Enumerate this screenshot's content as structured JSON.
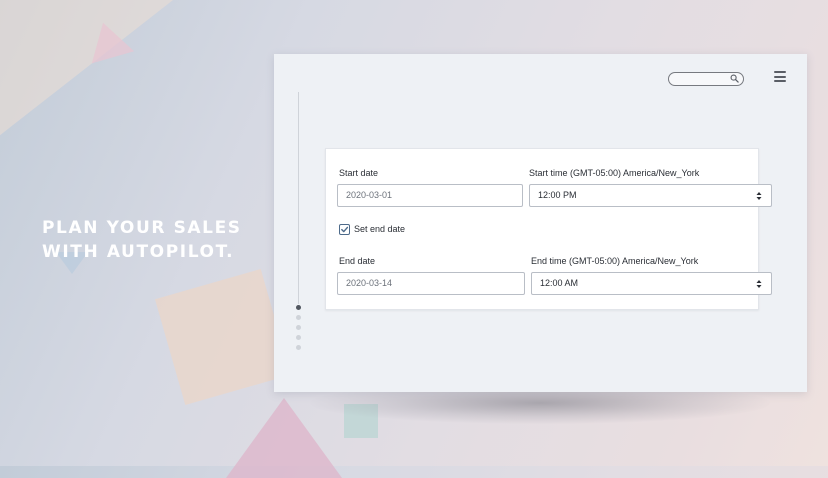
{
  "headline": {
    "line1": "PLAN YOUR SALES",
    "line2": "WITH AUTOPILOT."
  },
  "toolbar": {
    "search_value": "",
    "search_icon": "magnifier-icon",
    "menu_icon": "hamburger-icon"
  },
  "form": {
    "start_date_label": "Start date",
    "start_date_value": "2020-03-01",
    "start_time_label": "Start time (GMT-05:00) America/New_York",
    "start_time_value": "12:00 PM",
    "set_end_date_label": "Set end date",
    "set_end_date_checked": true,
    "end_date_label": "End date",
    "end_date_value": "2020-03-14",
    "end_time_label": "End time (GMT-05:00) America/New_York",
    "end_time_value": "12:00 AM"
  },
  "timeline": {
    "step_count": 5,
    "active_step": 1
  },
  "colors": {
    "accent": "#4d6a8a",
    "window_bg": "#eef1f5",
    "card_bg": "#ffffff"
  }
}
